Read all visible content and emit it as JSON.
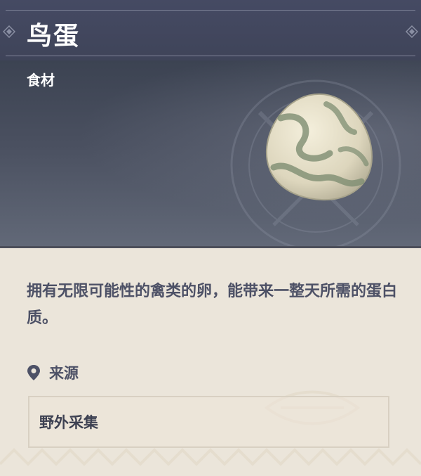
{
  "item": {
    "name": "鸟蛋",
    "category": "食材",
    "description": "拥有无限可能性的禽类的卵，能带来一整天所需的蛋白质。",
    "source_title": "来源",
    "sources": [
      "野外采集"
    ]
  },
  "icons": {
    "title_decoration": "diamond-ornament-icon",
    "source": "location-pin-icon",
    "item_image": "bird-egg-icon"
  },
  "colors": {
    "header_bg": "#454a63",
    "body_bg": "#ebe5da",
    "text_dark": "#4d5166",
    "title_text": "#ffffff"
  }
}
